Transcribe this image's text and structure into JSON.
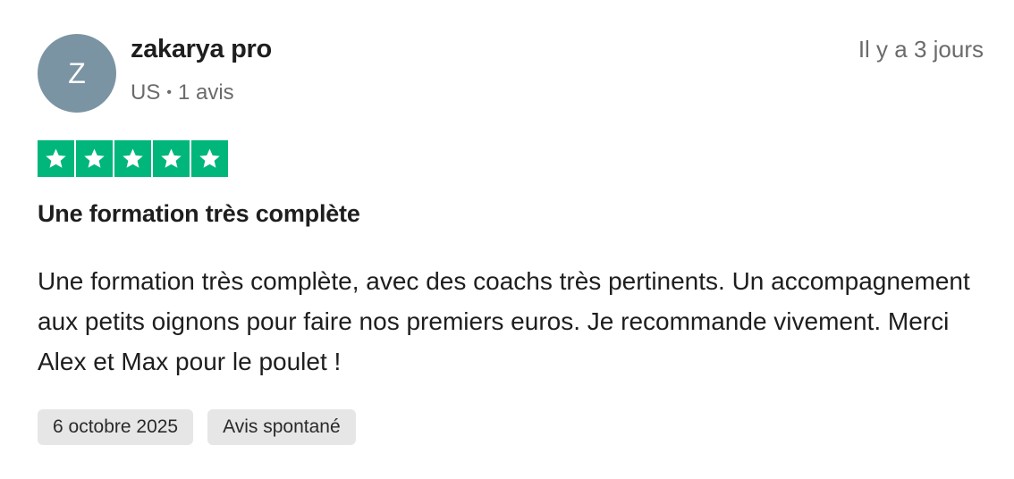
{
  "reviewer": {
    "initial": "Z",
    "name": "zakarya pro",
    "country": "US",
    "separator": "•",
    "review_count": "1 avis",
    "avatar_color": "#7b94a3"
  },
  "review": {
    "relative_time": "Il y a 3 jours",
    "rating": 5,
    "rating_max": 5,
    "star_color": "#00b67a",
    "title": "Une formation très complète",
    "body": "Une formation très complète, avec des coachs très pertinents. Un accompagnement aux petits oignons pour faire nos premiers euros. Je recommande vivement. Merci Alex et Max pour le poulet !",
    "tags": {
      "date": "6 octobre 2025",
      "type": "Avis spontané"
    }
  },
  "icons": {
    "star": "star-icon"
  }
}
